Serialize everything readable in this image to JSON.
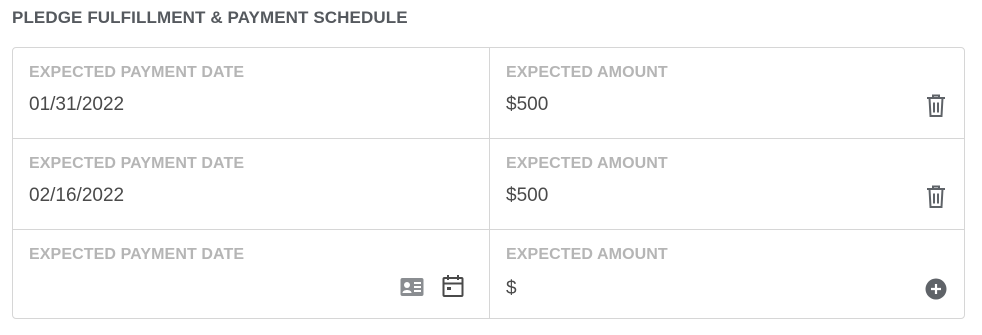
{
  "section": {
    "title": "PLEDGE FULFILLMENT & PAYMENT SCHEDULE"
  },
  "rows": [
    {
      "date_label": "EXPECTED PAYMENT DATE",
      "date_value": "01/31/2022",
      "amount_label": "EXPECTED AMOUNT",
      "amount_value": "$500",
      "action_icon": "trash-icon"
    },
    {
      "date_label": "EXPECTED PAYMENT DATE",
      "date_value": "02/16/2022",
      "amount_label": "EXPECTED AMOUNT",
      "amount_value": "$500",
      "action_icon": "trash-icon"
    },
    {
      "date_label": "EXPECTED PAYMENT DATE",
      "date_value": "",
      "amount_label": "EXPECTED AMOUNT",
      "amount_value": "$",
      "date_icons": [
        "contact-card-icon",
        "calendar-icon"
      ],
      "action_icon": "add-circle-icon"
    }
  ],
  "colors": {
    "title": "#55595e",
    "label": "#b5b5b5",
    "value": "#4a4a4a",
    "border": "#d6d6d6",
    "icon": "#5f6368"
  }
}
